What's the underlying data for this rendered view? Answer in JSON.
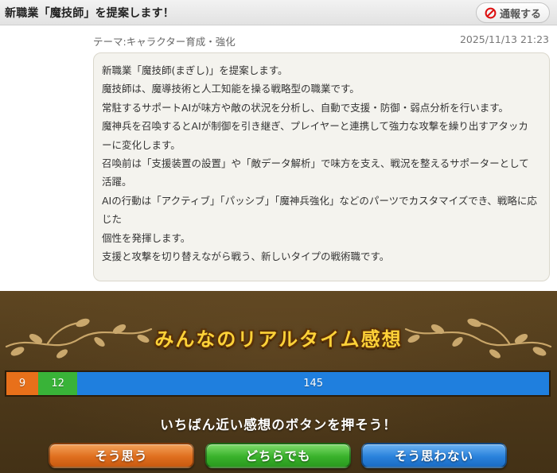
{
  "header": {
    "title": "新職業「魔技師」を提案します！",
    "report_label": "通報する"
  },
  "meta": {
    "theme": "テーマ:キャラクター育成・強化",
    "date": "2025/11/13 21:23"
  },
  "article": {
    "lines": [
      "新職業「魔技師(まぎし)」を提案します。",
      "魔技師は、魔導技術と人工知能を操る戦略型の職業です。",
      "常駐するサポートAIが味方や敵の状況を分析し、自動で支援・防御・弱点分析を行います。",
      "魔神兵を召喚するとAIが制御を引き継ぎ、プレイヤーと連携して強力な攻撃を繰り出すアタッカ",
      "ーに変化します。",
      "召喚前は「支援装置の設置」や「敵データ解析」で味方を支え、戦況を整えるサポーターとして",
      "活躍。",
      "AIの行動は「アクティブ」「パッシブ」「魔神兵強化」などのパーツでカスタマイズでき、戦略に応じた",
      "個性を発揮します。",
      "支援と攻撃を切り替えながら戦う、新しいタイプの戦術職です。"
    ]
  },
  "reactions": {
    "title": "みんなのリアルタイム感想",
    "prompt": "いちばん近い感想のボタンを押そう！",
    "counts": {
      "agree": 9,
      "neutral": 12,
      "disagree": 145
    },
    "buttons": {
      "agree": "そう思う",
      "neutral": "どちらでも",
      "disagree": "そう思わない"
    },
    "colors": {
      "agree": "#e8701a",
      "neutral": "#39b338",
      "disagree": "#1f7fde",
      "title": "#ffd238",
      "panel": "#4b3719"
    }
  }
}
